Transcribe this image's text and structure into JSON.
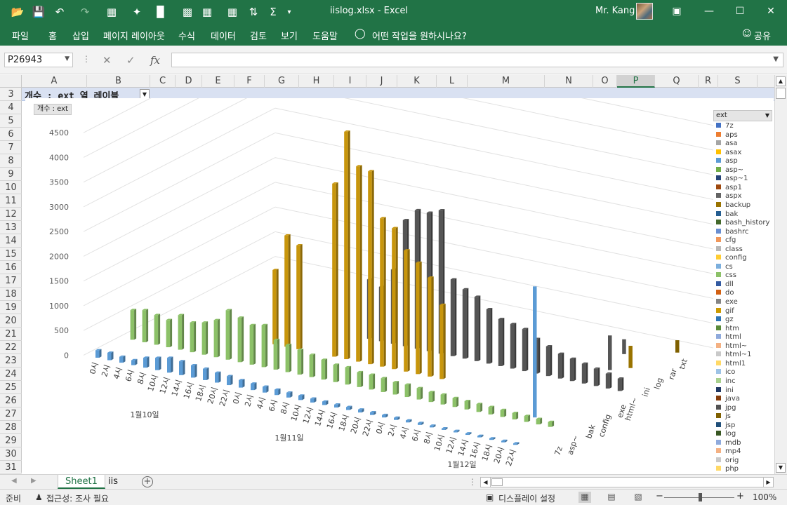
{
  "window": {
    "doc_title": "iislog.xlsx  -  Excel",
    "user": "Mr. Kang",
    "qat_icons": [
      "open-icon",
      "save-icon",
      "undo-icon",
      "redo-icon",
      "pivot-icon",
      "chart-icon",
      "bar-chart-icon",
      "org-icon",
      "table-icon",
      "formula-icon",
      "sort-icon",
      "sum-icon",
      "customize-icon"
    ]
  },
  "ribbon": {
    "tabs": [
      "파일",
      "홈",
      "삽입",
      "페이지 레이아웃",
      "수식",
      "데이터",
      "검토",
      "보기",
      "도움말"
    ],
    "tell_me": "어떤 작업을 원하시나요?",
    "share": "공유"
  },
  "formula_bar": {
    "name_box": "P26943",
    "fx": "fx",
    "formula": ""
  },
  "grid": {
    "columns": [
      "A",
      "B",
      "C",
      "D",
      "E",
      "F",
      "G",
      "H",
      "I",
      "J",
      "K",
      "L",
      "M",
      "N",
      "O",
      "P",
      "Q",
      "R",
      "S"
    ],
    "selected_column": "P",
    "rows": [
      "3",
      "4",
      "5",
      "6",
      "7",
      "8",
      "9",
      "10",
      "11",
      "12",
      "13",
      "14",
      "15",
      "16",
      "17",
      "18",
      "19",
      "20",
      "21",
      "22",
      "23",
      "24",
      "25",
      "26",
      "27",
      "28",
      "29",
      "30",
      "31"
    ],
    "pivot_header": "개수 : ext  열 레이블"
  },
  "chart_data": {
    "type": "bar",
    "projection": "3d-column",
    "value_field": "개수 : ext",
    "legend_title": "ext",
    "z_axis_ticks": [
      "0",
      "500",
      "1000",
      "1500",
      "2000",
      "2500",
      "3000",
      "3500",
      "4000",
      "4500"
    ],
    "ylim": [
      0,
      4500
    ],
    "x_tick_labels": [
      "0시",
      "2시",
      "4시",
      "6시",
      "8시",
      "10시",
      "12시",
      "14시",
      "16시",
      "18시",
      "20시",
      "22시",
      "0시",
      "2시",
      "4시",
      "6시",
      "8시",
      "10시",
      "12시",
      "14시",
      "16시",
      "18시",
      "20시",
      "22시",
      "0시",
      "2시",
      "4시",
      "6시",
      "8시",
      "10시",
      "12시",
      "14시",
      "16시",
      "18시",
      "20시",
      "22시"
    ],
    "x_group_labels": [
      "1월10일",
      "1월11일",
      "1월12일"
    ],
    "depth_labels": [
      "7z",
      "asp~",
      "bak",
      "config",
      "exe",
      "html~",
      "ini",
      "log",
      "rar",
      "txt"
    ],
    "legend": [
      {
        "name": "7z",
        "color": "#4472c4"
      },
      {
        "name": "aps",
        "color": "#ed7d31"
      },
      {
        "name": "asa",
        "color": "#a5a5a5"
      },
      {
        "name": "asax",
        "color": "#ffc000"
      },
      {
        "name": "asp",
        "color": "#5b9bd5"
      },
      {
        "name": "asp~",
        "color": "#70ad47"
      },
      {
        "name": "asp~1",
        "color": "#264478"
      },
      {
        "name": "asp1",
        "color": "#9e480e"
      },
      {
        "name": "aspx",
        "color": "#636363"
      },
      {
        "name": "backup",
        "color": "#997300"
      },
      {
        "name": "bak",
        "color": "#255e91"
      },
      {
        "name": "bash_history",
        "color": "#43682b"
      },
      {
        "name": "bashrc",
        "color": "#698ed0"
      },
      {
        "name": "cfg",
        "color": "#f1975a"
      },
      {
        "name": "class",
        "color": "#b7b7b7"
      },
      {
        "name": "config",
        "color": "#ffcd33"
      },
      {
        "name": "cs",
        "color": "#7cafdd"
      },
      {
        "name": "css",
        "color": "#8cc168"
      },
      {
        "name": "dll",
        "color": "#335aa1"
      },
      {
        "name": "do",
        "color": "#d26012"
      },
      {
        "name": "exe",
        "color": "#848484"
      },
      {
        "name": "gif",
        "color": "#cc9a00"
      },
      {
        "name": "gz",
        "color": "#2e75b6"
      },
      {
        "name": "htm",
        "color": "#5a8a39"
      },
      {
        "name": "html",
        "color": "#8faadc"
      },
      {
        "name": "html~",
        "color": "#f4b183"
      },
      {
        "name": "html~1",
        "color": "#c9c9c9"
      },
      {
        "name": "html1",
        "color": "#ffd966"
      },
      {
        "name": "ico",
        "color": "#9dc3e6"
      },
      {
        "name": "inc",
        "color": "#a9d18e"
      },
      {
        "name": "ini",
        "color": "#203864"
      },
      {
        "name": "java",
        "color": "#843c0c"
      },
      {
        "name": "jpg",
        "color": "#525252"
      },
      {
        "name": "js",
        "color": "#7f6000"
      },
      {
        "name": "jsp",
        "color": "#1f4e79"
      },
      {
        "name": "log",
        "color": "#385723"
      },
      {
        "name": "mdb",
        "color": "#8faadc"
      },
      {
        "name": "mp4",
        "color": "#f4b183"
      },
      {
        "name": "orig",
        "color": "#c9c9c9"
      },
      {
        "name": "php",
        "color": "#ffd966"
      }
    ],
    "series": [
      {
        "name": "gif",
        "color": "#c8960c",
        "values": [
          0,
          0,
          0,
          0,
          0,
          0,
          0,
          0,
          0,
          1500,
          2250,
          2100,
          0,
          0,
          3500,
          4600,
          3950,
          3900,
          3000,
          2850,
          2450,
          2250,
          2000,
          1500,
          0,
          0,
          0,
          0,
          0,
          0,
          0,
          0,
          0,
          0,
          0,
          0
        ]
      },
      {
        "name": "jpg",
        "color": "#555555",
        "values": [
          0,
          0,
          0,
          0,
          0,
          0,
          0,
          0,
          0,
          0,
          0,
          0,
          0,
          0,
          1200,
          1100,
          1500,
          2550,
          2800,
          2800,
          2900,
          1550,
          1400,
          1300,
          1100,
          950,
          900,
          850,
          700,
          600,
          500,
          450,
          400,
          350,
          300,
          250
        ]
      },
      {
        "name": "css",
        "color": "#8cc168",
        "values": [
          600,
          650,
          600,
          550,
          700,
          600,
          650,
          750,
          1000,
          900,
          800,
          850,
          600,
          550,
          500,
          450,
          400,
          350,
          350,
          300,
          300,
          280,
          250,
          250,
          230,
          200,
          200,
          180,
          170,
          160,
          150,
          140,
          130,
          120,
          110,
          100
        ]
      },
      {
        "name": "asp",
        "color": "#5b9bd5",
        "values": [
          150,
          150,
          120,
          100,
          200,
          250,
          300,
          280,
          250,
          230,
          200,
          180,
          150,
          130,
          120,
          110,
          100,
          90,
          80,
          70,
          60,
          60,
          60,
          55,
          50,
          45,
          40,
          40,
          35,
          30,
          30,
          30,
          30,
          30,
          30,
          30
        ]
      }
    ]
  },
  "sheet_tabs": [
    "Sheet1",
    "iis"
  ],
  "active_sheet": "Sheet1",
  "status": {
    "ready": "준비",
    "accessibility": "접근성: 조사 필요",
    "display_settings": "디스플레이 설정",
    "zoom": "100%"
  }
}
